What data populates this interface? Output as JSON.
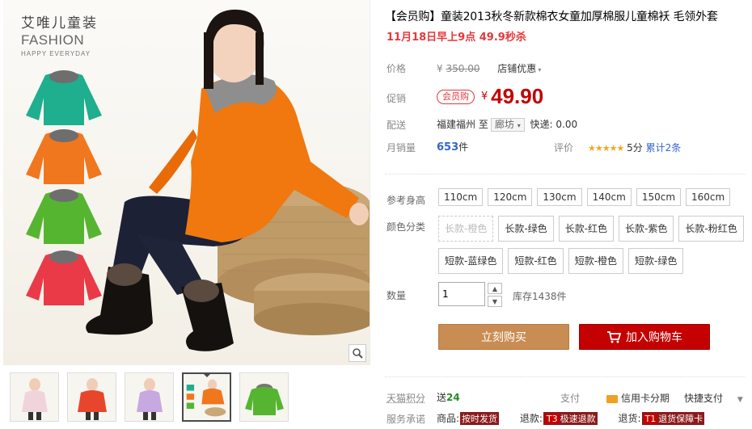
{
  "brand": {
    "cn": "艾唯儿童装",
    "en": "FASHION",
    "sub": "HAPPY EVERYDAY"
  },
  "gallery": {
    "variant_colors": [
      "#1fae8e",
      "#f0771e",
      "#56b530",
      "#ea3a48"
    ],
    "thumbnails": [
      {
        "name": "thumb-pink"
      },
      {
        "name": "thumb-red"
      },
      {
        "name": "thumb-purple"
      },
      {
        "name": "thumb-orange",
        "active": true
      },
      {
        "name": "thumb-green"
      }
    ]
  },
  "product": {
    "title": "【会员购】童装2013秋冬新款棉衣女童加厚棉服儿童棉袄 毛领外套",
    "subtitle": "11月18日早上9点 49.9秒杀"
  },
  "meta": {
    "price_label": "价格",
    "price_yen": "¥",
    "price_original": "350.00",
    "shop_promo": "店铺优惠",
    "promo_label": "促销",
    "promo_badge": "会员购",
    "promo_yen": "¥",
    "promo_price": "49.90",
    "ship_label": "配送",
    "ship_from": "福建福州",
    "ship_to_word": "至",
    "ship_to": "廊坊",
    "ship_fee": "快递: 0.00",
    "sales_label": "月销量",
    "sales_count": "653",
    "sales_unit": "件",
    "rating_label": "评价",
    "rating_stars": "★★★★★",
    "rating_score": "5分",
    "rating_total": "累计2条"
  },
  "options": {
    "size_label": "参考身高",
    "sizes": [
      "110cm",
      "120cm",
      "130cm",
      "140cm",
      "150cm",
      "160cm"
    ],
    "color_label": "颜色分类",
    "colors_row1": [
      "长款-橙色",
      "长款-绿色",
      "长款-红色",
      "长款-紫色",
      "长款-粉红色"
    ],
    "colors_row2": [
      "短款-蓝绿色",
      "短款-红色",
      "短款-橙色",
      "短款-绿色"
    ],
    "qty_label": "数量",
    "qty_value": "1",
    "stock": "库存1438件"
  },
  "actions": {
    "buy": "立刻购买",
    "cart": "加入购物车"
  },
  "footer": {
    "points_label": "天猫积分",
    "points_prefix": "送",
    "points_value": "24",
    "pay_label": "支付",
    "credit": "信用卡分期",
    "fast_pay": "快捷支付",
    "service_label": "服务承诺",
    "goods_label": "商品:",
    "goods_tag": "按时发货",
    "refund_label": "退款:",
    "refund_code": "T3",
    "refund_tag": "极速退款",
    "return_label": "退货:",
    "return_code": "T1",
    "return_tag": "退货保障卡"
  }
}
